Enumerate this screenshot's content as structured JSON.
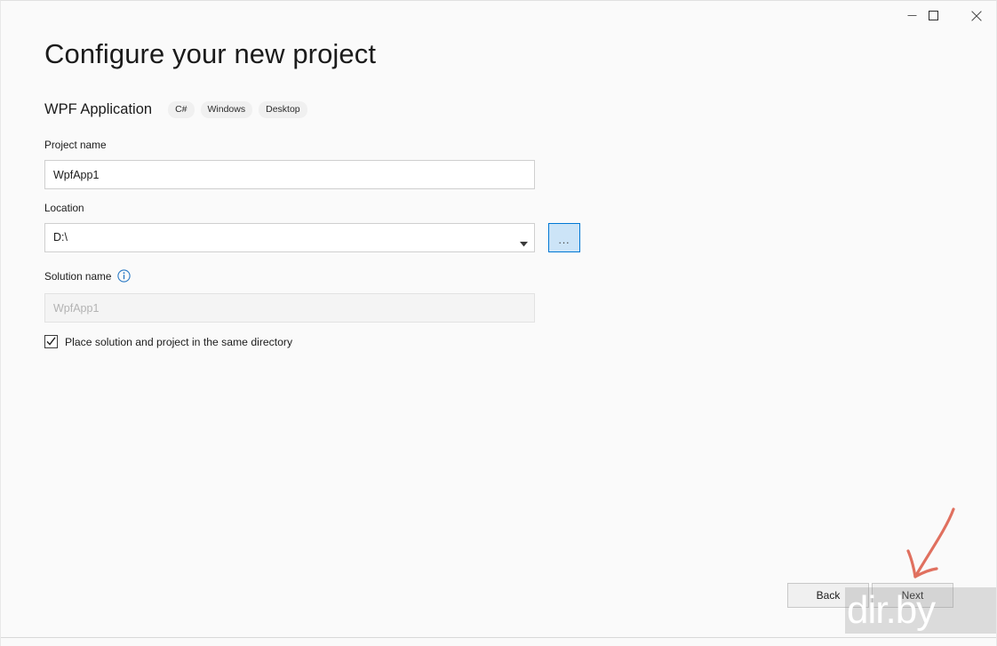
{
  "window": {
    "controls": {
      "minimize_label": "Minimize",
      "maximize_label": "Maximize",
      "close_label": "Close"
    }
  },
  "page": {
    "title": "Configure your new project",
    "template_name": "WPF Application",
    "tags": [
      "C#",
      "Windows",
      "Desktop"
    ]
  },
  "form": {
    "project_name": {
      "label": "Project name",
      "value": "WpfApp1",
      "placeholder": ""
    },
    "location": {
      "label": "Location",
      "value": "D:\\",
      "browse_label": "...",
      "dropdown_icon": "chevron-down-icon"
    },
    "solution_name": {
      "label": "Solution name",
      "value": "",
      "placeholder": "WpfApp1",
      "info_icon": "info-icon",
      "disabled": true
    },
    "same_directory_checkbox": {
      "label": "Place solution and project in the same directory",
      "checked": true
    }
  },
  "footer": {
    "back_label": "Back",
    "next_label": "Next"
  },
  "annotations": {
    "arrow": {
      "name": "red-arrow-annotation",
      "color": "#e0705f",
      "points_to": "next-button"
    },
    "watermark": {
      "text": "dir.by",
      "color": "#ffffff"
    }
  },
  "colors": {
    "accent": "#0078d4",
    "browse_fill": "#cce4f7",
    "page_background": "#fafafa",
    "input_background": "#ffffff",
    "disabled_background": "#f4f4f4",
    "tag_background": "#f0f0f0"
  }
}
